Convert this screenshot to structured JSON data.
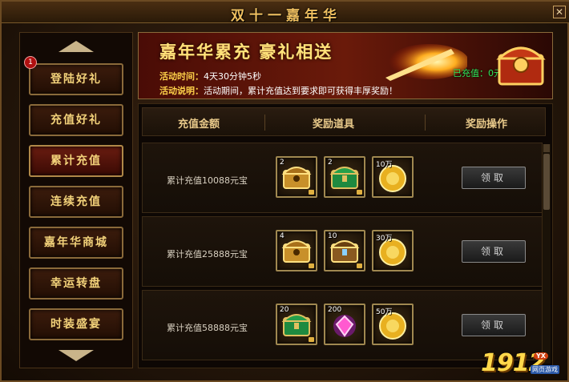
{
  "window": {
    "title": "双十一嘉年华",
    "close_glyph": "✕"
  },
  "sidebar": {
    "badge": "1",
    "items": [
      {
        "label": "登陆好礼"
      },
      {
        "label": "充值好礼"
      },
      {
        "label": "累计充值"
      },
      {
        "label": "连续充值"
      },
      {
        "label": "嘉年华商城"
      },
      {
        "label": "幸运转盘"
      },
      {
        "label": "时装盛宴"
      }
    ]
  },
  "banner": {
    "title": "嘉年华累充 豪礼相送",
    "time_label": "活动时间：",
    "time_value": "4天30分钟5秒",
    "desc_label": "活动说明：",
    "desc_value": "活动期间，累计充值达到要求即可获得丰厚奖励！",
    "recharged": "已充值：0元宝"
  },
  "table": {
    "headers": [
      "充值金额",
      "奖励道具",
      "奖励操作"
    ],
    "rows": [
      {
        "label": "累计充值10088元宝",
        "items": [
          {
            "qty": "2",
            "icon": "gold-chest-icon"
          },
          {
            "qty": "2",
            "icon": "green-chest-icon"
          },
          {
            "qty": "10万",
            "icon": "gold-coin-icon"
          }
        ],
        "button": "领取"
      },
      {
        "label": "累计充值25888元宝",
        "items": [
          {
            "qty": "4",
            "icon": "gold-chest-icon"
          },
          {
            "qty": "10",
            "icon": "treasure-chest-icon"
          },
          {
            "qty": "30万",
            "icon": "gold-coin-icon"
          }
        ],
        "button": "领取"
      },
      {
        "label": "累计充值58888元宝",
        "items": [
          {
            "qty": "20",
            "icon": "green-chest-icon"
          },
          {
            "qty": "200",
            "icon": "pink-gem-icon"
          },
          {
            "qty": "50万",
            "icon": "gold-coin-icon"
          }
        ],
        "button": "领取"
      }
    ]
  },
  "logo": {
    "number": "1912",
    "tag": "YX",
    "sub": "网页游戏"
  }
}
